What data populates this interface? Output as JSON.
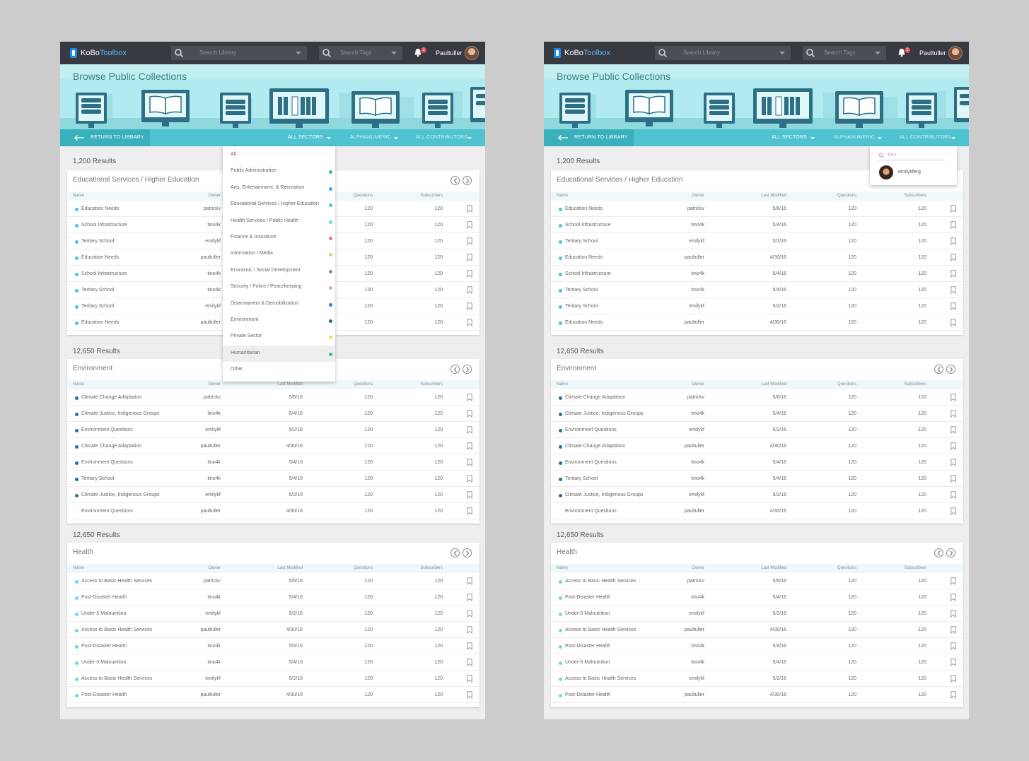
{
  "header": {
    "logo_ko": "KoBo",
    "logo_toolbox": "Toolbox",
    "search_library_placeholder": "Search Library",
    "search_tags_placeholder": "Search Tags",
    "notification_count": "2",
    "username": "Paultuller"
  },
  "hero": {
    "title": "Browse Public Collections"
  },
  "filters": {
    "return_label": "RETURN TO LIBRARY",
    "sectors_label": "ALL SECTORS",
    "sort_label": "ALPHANUMERIC",
    "contributors_label": "ALL CONTRIBUTORS"
  },
  "columns": {
    "name": "Name",
    "owner": "Owner",
    "modified": "Last Modified",
    "questions": "Questions",
    "subscribers": "Subscribers"
  },
  "sector_dropdown": [
    {
      "label": "All",
      "color": ""
    },
    {
      "label": "Public Administration",
      "color": "#26bfa5"
    },
    {
      "label": "Arts, Entertainment, & Recreation",
      "color": "#42a5f5"
    },
    {
      "label": "Educational Services / Higher Educaiton",
      "color": "#4fc3cf"
    },
    {
      "label": "Health Services / Public Health",
      "color": "#6fd6ea"
    },
    {
      "label": "Finance & Insurance",
      "color": "#ef6c7b"
    },
    {
      "label": "Information / Media",
      "color": "#b6e07a"
    },
    {
      "label": "Economic / Social Development",
      "color": "#888888"
    },
    {
      "label": "Security / Police / Peacekeeping",
      "color": "#e89ae8"
    },
    {
      "label": "Disarmament & Demobilization",
      "color": "#3b7fc4"
    },
    {
      "label": "Environment",
      "color": "#2c6e91"
    },
    {
      "label": "Private Sector",
      "color": "#f1e33b"
    },
    {
      "label": "Humanitarian",
      "color": "#26bfa5"
    },
    {
      "label": "Other",
      "color": ""
    }
  ],
  "contributor_search": {
    "query": "Emi",
    "result": "emilykferg"
  },
  "sections": [
    {
      "count": "1,200 Results",
      "title": "Educational Services / Higher Education",
      "color": "#4fc3cf",
      "rows": [
        {
          "name": "Education Needs",
          "owner": "patrickv",
          "modified": "5/6/16",
          "questions": "120",
          "subscribers": "120",
          "dot": true
        },
        {
          "name": "School Infrastructure",
          "owner": "tino4k",
          "modified": "5/4/16",
          "questions": "120",
          "subscribers": "120",
          "dot": true
        },
        {
          "name": "Teritary School",
          "owner": "emilykf",
          "modified": "5/2/16",
          "questions": "120",
          "subscribers": "120",
          "dot": true
        },
        {
          "name": "Education Needs",
          "owner": "paultuller",
          "modified": "4/30/16",
          "questions": "120",
          "subscribers": "120",
          "dot": true
        },
        {
          "name": "School Infrastructure",
          "owner": "tino4k",
          "modified": "5/4/16",
          "questions": "120",
          "subscribers": "120",
          "dot": true
        },
        {
          "name": "Teritary School",
          "owner": "tino4k",
          "modified": "5/4/16",
          "questions": "120",
          "subscribers": "120",
          "dot": true
        },
        {
          "name": "Teritary School",
          "owner": "emilykf",
          "modified": "5/2/16",
          "questions": "120",
          "subscribers": "120",
          "dot": true
        },
        {
          "name": "Education Needs",
          "owner": "paultuller",
          "modified": "4/30/16",
          "questions": "120",
          "subscribers": "120",
          "dot": true
        }
      ]
    },
    {
      "count": "12,650 Results",
      "title": "Environment",
      "color": "#2c6e91",
      "rows": [
        {
          "name": "Climate Change Adaptation",
          "owner": "patrickv",
          "modified": "5/6/16",
          "questions": "120",
          "subscribers": "120",
          "dot": true
        },
        {
          "name": "Climate Justice, Indigenous Groups",
          "owner": "tino4k",
          "modified": "5/4/16",
          "questions": "120",
          "subscribers": "120",
          "dot": true
        },
        {
          "name": "Environment Questions",
          "owner": "emilykf",
          "modified": "5/2/16",
          "questions": "120",
          "subscribers": "120",
          "dot": true
        },
        {
          "name": "Climate Change Adaptation",
          "owner": "paultuller",
          "modified": "4/30/16",
          "questions": "120",
          "subscribers": "120",
          "dot": true
        },
        {
          "name": "Environment Questions",
          "owner": "tino4k",
          "modified": "5/4/16",
          "questions": "120",
          "subscribers": "120",
          "dot": true
        },
        {
          "name": "Teritary School",
          "owner": "tino4k",
          "modified": "5/4/16",
          "questions": "120",
          "subscribers": "120",
          "dot": true
        },
        {
          "name": "Climate Justice, Indigenous Groups",
          "owner": "emilykf",
          "modified": "5/2/16",
          "questions": "120",
          "subscribers": "120",
          "dot": true
        },
        {
          "name": "Environment Questions",
          "owner": "paultuller",
          "modified": "4/30/16",
          "questions": "120",
          "subscribers": "120",
          "dot": false
        }
      ]
    },
    {
      "count": "12,650 Results",
      "title": "Health",
      "color": "#6fd6ea",
      "rows": [
        {
          "name": "Access to Basic Health Services",
          "owner": "patrickv",
          "modified": "5/6/16",
          "questions": "120",
          "subscribers": "120",
          "dot": true
        },
        {
          "name": "Post-Disaster Health",
          "owner": "tino4k",
          "modified": "5/4/16",
          "questions": "120",
          "subscribers": "120",
          "dot": true
        },
        {
          "name": "Under-5 Malnutrition",
          "owner": "emilykf",
          "modified": "5/2/16",
          "questions": "120",
          "subscribers": "120",
          "dot": true
        },
        {
          "name": "Access to Basic Health Services",
          "owner": "paultuller",
          "modified": "4/30/16",
          "questions": "120",
          "subscribers": "120",
          "dot": true
        },
        {
          "name": "Post-Disaster Health",
          "owner": "tino4k",
          "modified": "5/4/16",
          "questions": "120",
          "subscribers": "120",
          "dot": true
        },
        {
          "name": "Under-5 Malnutrition",
          "owner": "tino4k",
          "modified": "5/4/16",
          "questions": "120",
          "subscribers": "120",
          "dot": true
        },
        {
          "name": "Access to Basic Health Services",
          "owner": "emilykf",
          "modified": "5/2/16",
          "questions": "120",
          "subscribers": "120",
          "dot": true
        },
        {
          "name": "Post-Disaster Health",
          "owner": "paultuller",
          "modified": "4/30/16",
          "questions": "120",
          "subscribers": "120",
          "dot": true
        }
      ]
    }
  ]
}
